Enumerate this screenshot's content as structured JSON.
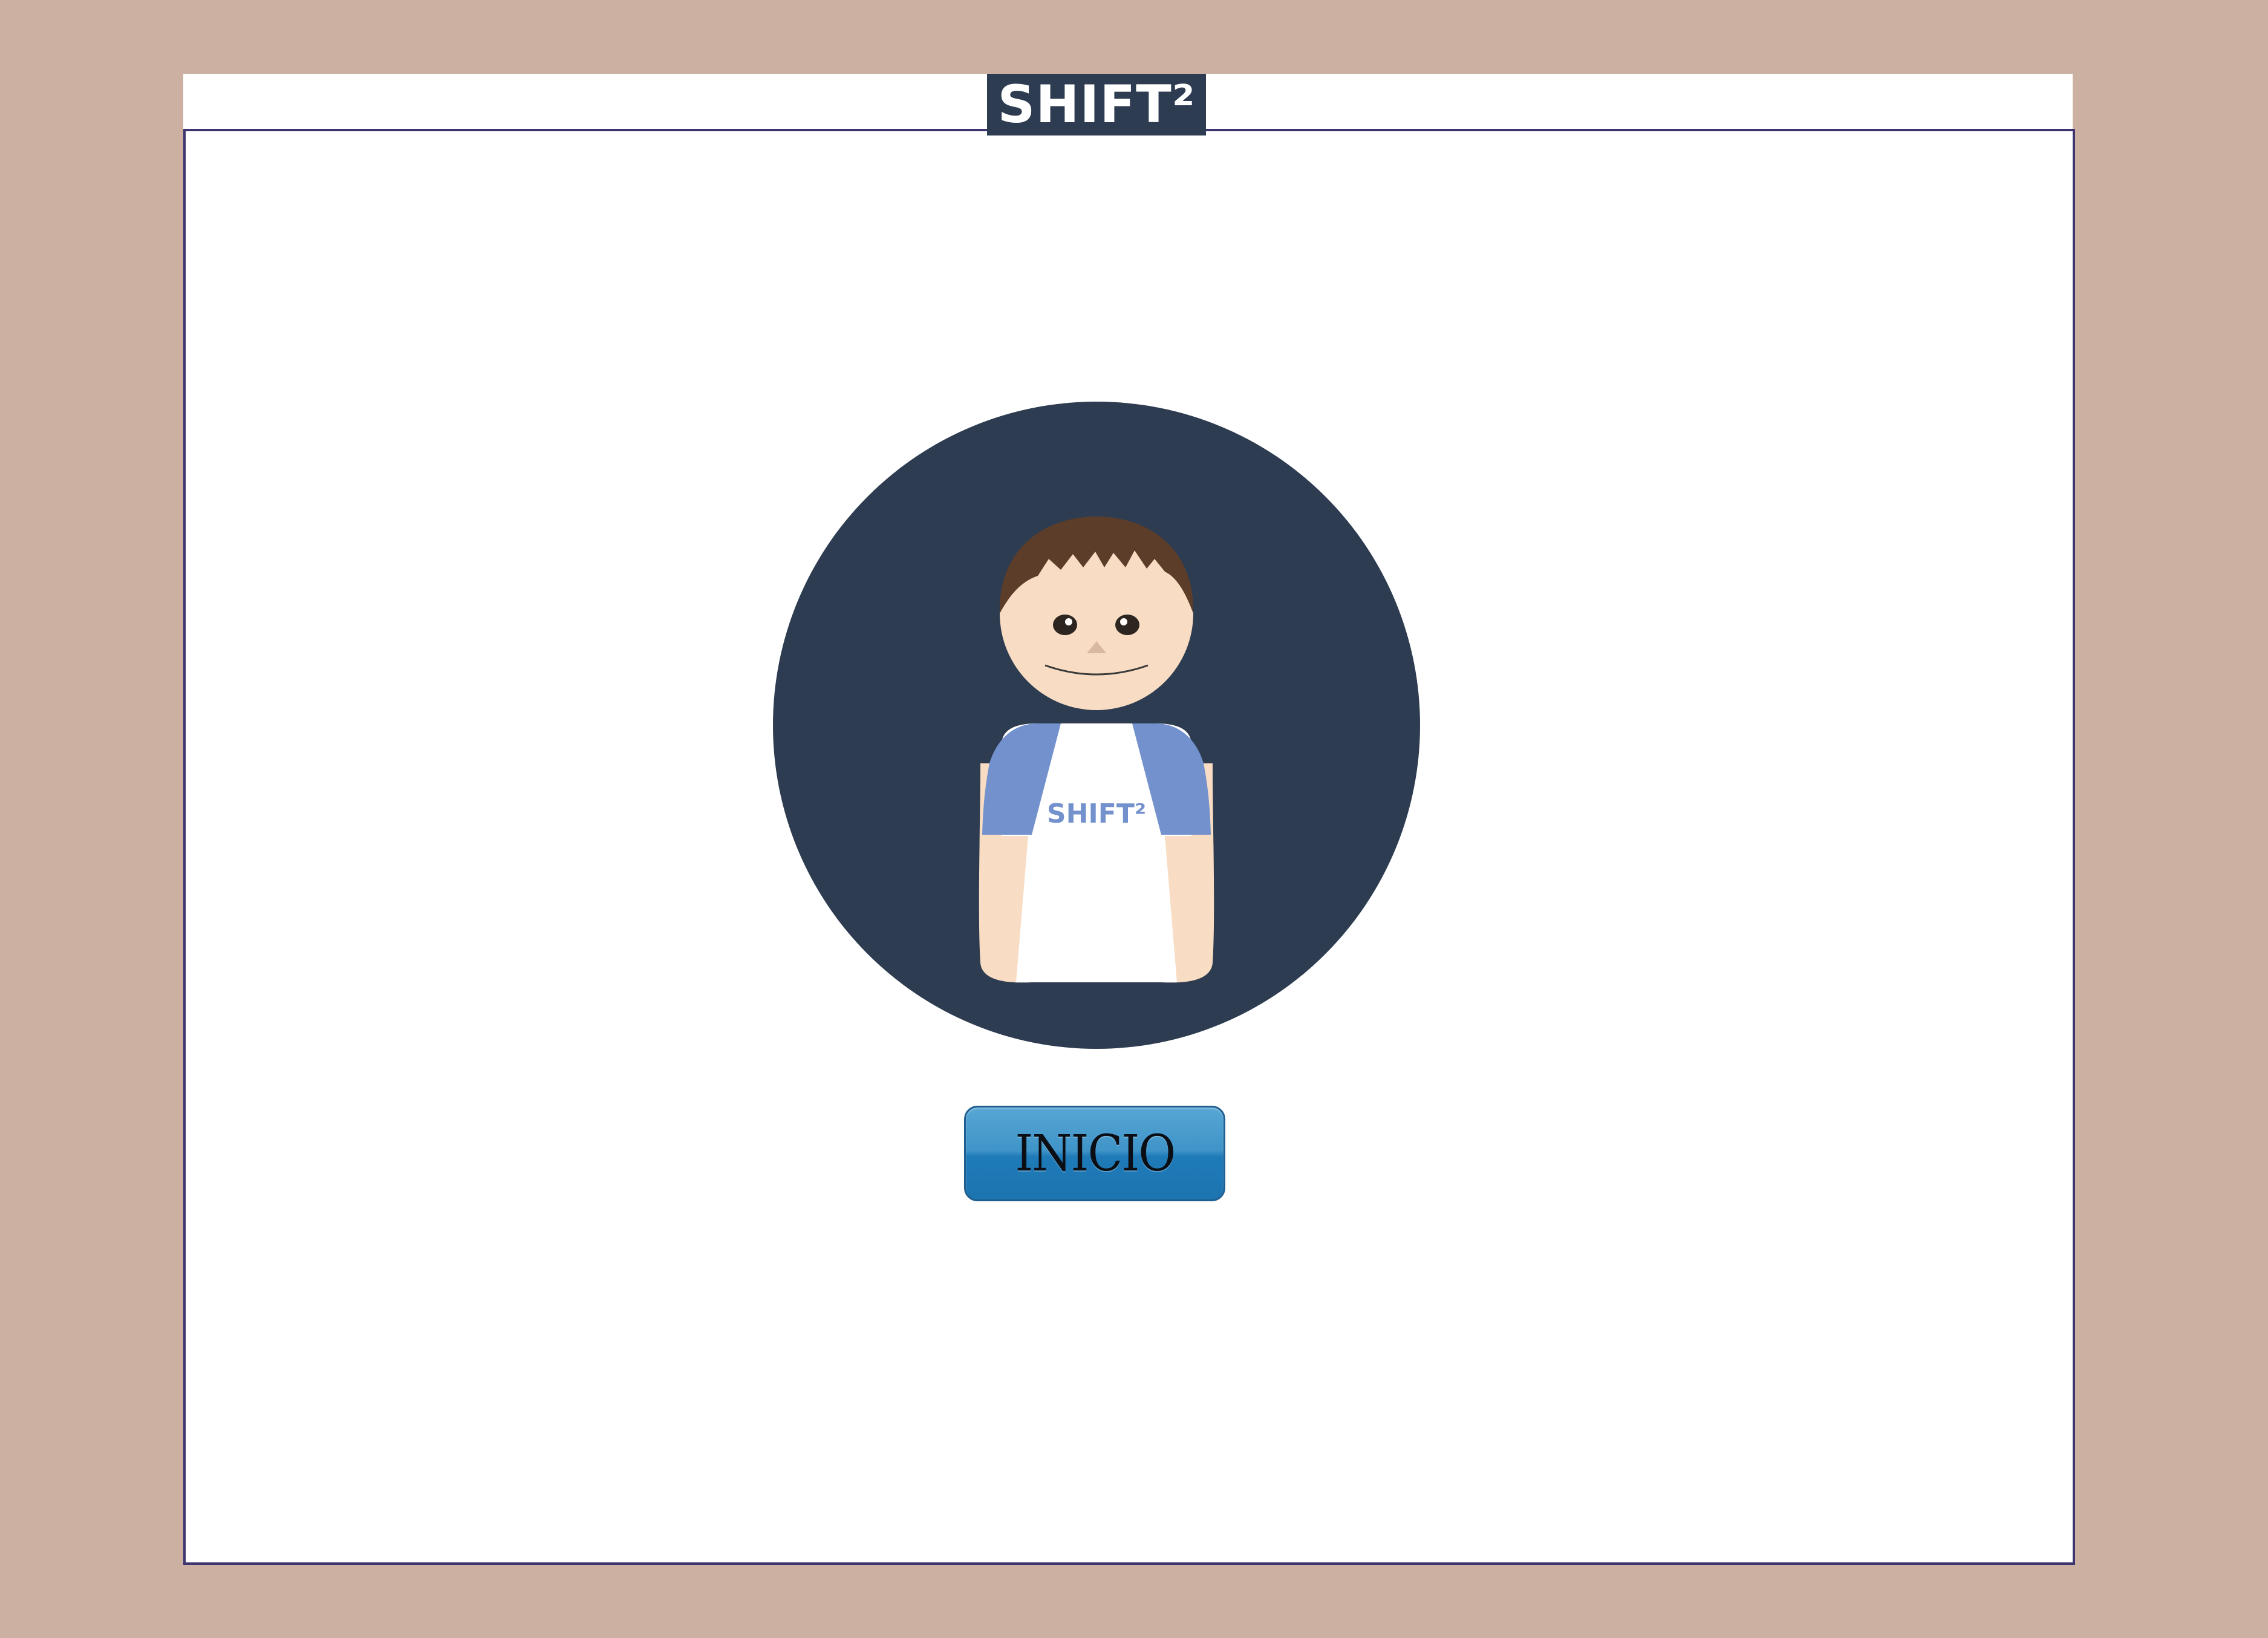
{
  "header": {
    "logo_text": "SHIFT²"
  },
  "avatar": {
    "shirt_text": "SHIFT²",
    "colors": {
      "circle": "#2d3c50",
      "hair": "#5b3d29",
      "skin": "#f8dcc3",
      "sleeve": "#7391cc",
      "shirt": "#ffffff"
    }
  },
  "main": {
    "start_button_label": "INICIO"
  },
  "colors": {
    "page_background": "#ccb1a3",
    "frame_border": "#3d3470",
    "button_blue": "#1f7bb8"
  }
}
